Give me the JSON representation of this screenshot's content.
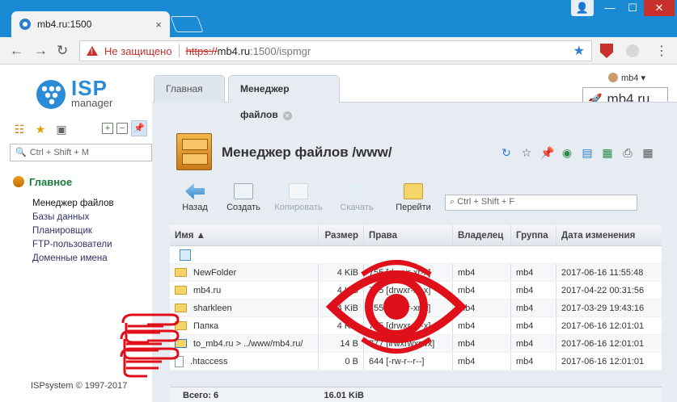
{
  "browser": {
    "tab_title": "mb4.ru:1500",
    "tab_close": "×",
    "insecure_label": "Не защищено",
    "url_proto": "https://",
    "url_host": "mb4.ru",
    "url_path": ":1500/ispmgr"
  },
  "logo": {
    "line1": "ISP",
    "line2": "manager"
  },
  "user": {
    "name": "mb4 ▾"
  },
  "brand": {
    "text": "mb4.ru"
  },
  "sidebar": {
    "search_placeholder": "Ctrl + Shift + M",
    "group_label": "Главное",
    "items": [
      {
        "label": "Менеджер файлов"
      },
      {
        "label": "Базы данных"
      },
      {
        "label": "Планировщик"
      },
      {
        "label": "FTP-пользователи"
      },
      {
        "label": "Доменные имена"
      }
    ],
    "copyright": "ISPsystem © 1997-2017"
  },
  "tabs": [
    {
      "label": "Главная"
    },
    {
      "label": "Менеджер файлов"
    }
  ],
  "page_title": "Менеджер файлов /www/",
  "toolbar": {
    "back": "Назад",
    "create": "Создать",
    "copy": "Копировать",
    "download": "Скачать",
    "goto": "Перейти",
    "search_placeholder": "Ctrl + Shift + F"
  },
  "table": {
    "columns": [
      "Имя ▲",
      "Размер",
      "Права",
      "Владелец",
      "Группа",
      "Дата изменения"
    ],
    "rows": [
      {
        "name": "NewFolder",
        "size": "4 KiB",
        "rights": "755 [drwxr-xr-x]",
        "owner": "mb4",
        "group": "mb4",
        "date": "2017-06-16 11:55:48"
      },
      {
        "name": "mb4.ru",
        "size": "4 KiB",
        "rights": "755 [drwxr-xr-x]",
        "owner": "mb4",
        "group": "mb4",
        "date": "2017-04-22 00:31:56"
      },
      {
        "name": "sharkleen",
        "size": "4 KiB",
        "rights": "755 [drwxr-xr-x]",
        "owner": "mb4",
        "group": "mb4",
        "date": "2017-03-29 19:43:16"
      },
      {
        "name": "Папка",
        "size": "4 KiB",
        "rights": "755 [drwxr-xr-x]",
        "owner": "mb4",
        "group": "mb4",
        "date": "2017-06-16 12:01:01"
      },
      {
        "name": "to_mb4.ru > ../www/mb4.ru/",
        "size": "14 B",
        "rights": "777 [lrwxrwxrwx]",
        "owner": "mb4",
        "group": "mb4",
        "date": "2017-06-16 12:01:01"
      },
      {
        "name": ".htaccess",
        "size": "0 B",
        "rights": "644 [-rw-r--r--]",
        "owner": "mb4",
        "group": "mb4",
        "date": "2017-06-16 12:01:01"
      }
    ],
    "footer_total": "Всего: 6",
    "footer_size": "16.01 KiB"
  },
  "colors": {
    "accent": "#1a8ad4",
    "annotation": "#e0101a"
  }
}
